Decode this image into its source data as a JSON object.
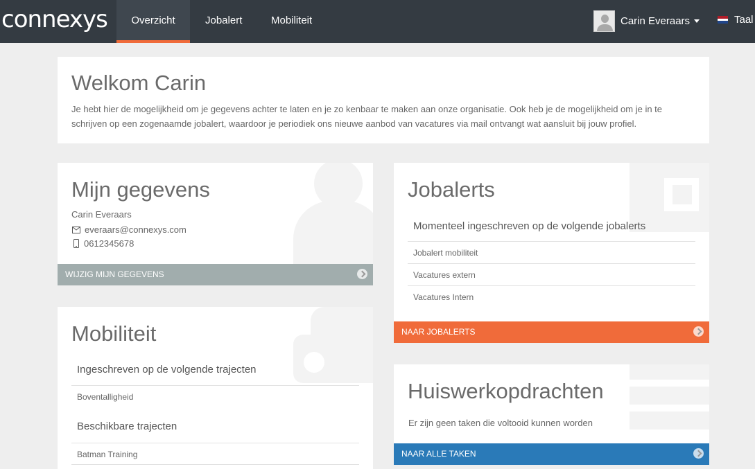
{
  "header": {
    "logo": "connexys",
    "nav": [
      "Overzicht",
      "Jobalert",
      "Mobiliteit"
    ],
    "user_name": "Carin Everaars",
    "language_label": "Taal"
  },
  "welcome": {
    "title": "Welkom Carin",
    "body": "Je hebt hier de mogelijkheid om je gegevens achter te laten en je zo kenbaar te maken aan onze organisatie. Ook heb je de mogelijkheid om je in te schrijven op een zogenaamde jobalert, waardoor je periodiek ons nieuwe aanbod van vacatures via mail ontvangt wat aansluit bij jouw profiel."
  },
  "profile": {
    "title": "Mijn gegevens",
    "name": "Carin Everaars",
    "email": "everaars@connexys.com",
    "phone": "0612345678",
    "button": "WIJZIG MIJN GEGEVENS"
  },
  "jobalerts": {
    "title": "Jobalerts",
    "subtitle": "Momenteel ingeschreven op de volgende jobalerts",
    "items": [
      "Jobalert mobiliteit",
      "Vacatures extern",
      "Vacatures Intern"
    ],
    "button": "NAAR JOBALERTS"
  },
  "mobility": {
    "title": "Mobiliteit",
    "enrolled_heading": "Ingeschreven op de volgende trajecten",
    "enrolled": [
      "Boventalligheid"
    ],
    "available_heading": "Beschikbare trajecten",
    "available": [
      "Batman Training"
    ]
  },
  "homework": {
    "title": "Huiswerkopdrachten",
    "empty_text": "Er zijn geen taken die voltooid kunnen worden",
    "button": "NAAR ALLE TAKEN"
  },
  "colors": {
    "navbar": "#343b42",
    "accent_orange": "#f06b3a",
    "footer_gray": "#a1adad",
    "footer_blue": "#2a7ab8"
  }
}
